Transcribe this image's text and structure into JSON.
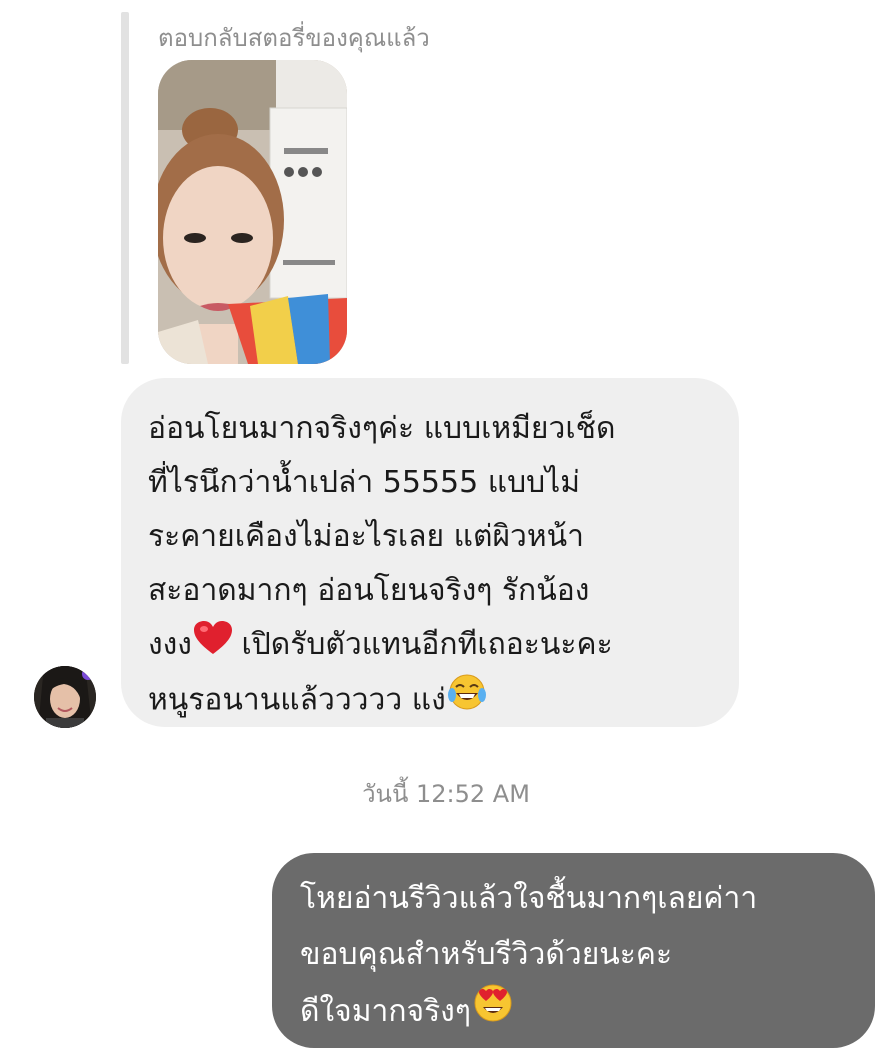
{
  "reply": {
    "label": "ตอบกลับสตอรี่ของคุณแล้ว"
  },
  "incoming": {
    "lines": [
      "อ่อนโยนมากจริงๆค่ะ แบบเหมียวเช็ด",
      "ที่ไรนึกว่าน้ำเปล่า 55555 แบบไม่",
      "ระคายเคืองไม่อะไรเลย แต่ผิวหน้า",
      "สะอาดมากๆ  อ่อนโยนจริงๆ รักน้อง",
      "งงง",
      "เปิดรับตัวแทนอีกทีเถอะนะคะ",
      "หนูรอนานแล้ววววว แง่"
    ]
  },
  "timestamp": "วันนี้ 12:52 AM",
  "outgoing": {
    "lines": [
      "โหยอ่านรีวิวแล้วใจชื้นมากๆเลยค่าา",
      "ขอบคุณสำหรับรีวิวด้วยนะคะ",
      "ดีใจมากจริงๆ"
    ]
  },
  "icons": {
    "heart": "red-heart-icon",
    "laugh": "tears-of-joy-icon",
    "heart_eyes": "heart-eyes-icon"
  },
  "colors": {
    "incoming_bubble": "#efefef",
    "outgoing_bubble": "#6b6b6b",
    "meta_text": "#8e8e8e"
  }
}
